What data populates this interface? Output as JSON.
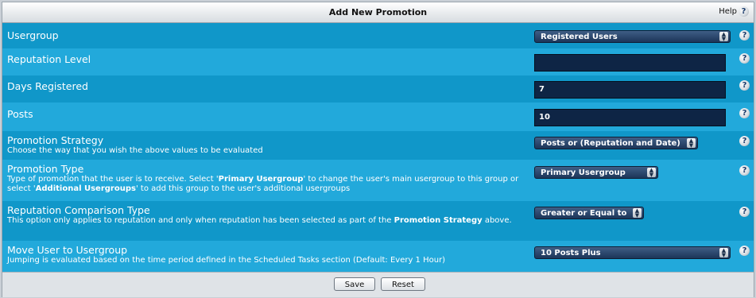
{
  "panel": {
    "title": "Add New Promotion",
    "help_label": "Help",
    "help_icon": "?"
  },
  "rows": [
    {
      "title": "Usergroup",
      "control": "select",
      "value": "Registered Users"
    },
    {
      "title": "Reputation Level",
      "control": "text",
      "value": ""
    },
    {
      "title": "Days Registered",
      "control": "text",
      "value": "7"
    },
    {
      "title": "Posts",
      "control": "text",
      "value": "10"
    },
    {
      "title": "Promotion Strategy",
      "desc": "Choose the way that you wish the above values to be evaluated",
      "control": "select",
      "value": "Posts or (Reputation and Date)"
    },
    {
      "title": "Promotion Type",
      "desc_parts": [
        "Type of promotion that the user is to receive. Select '",
        "Primary Usergroup",
        "' to change the user's main usergroup to this group or select '",
        "Additional Usergroups",
        "' to add this group to the user's additional usergroups"
      ],
      "control": "select",
      "value": "Primary Usergroup"
    },
    {
      "title": "Reputation Comparison Type",
      "desc_parts": [
        "This option only applies to reputation and only when reputation has been selected as part of the ",
        "Promotion Strategy",
        " above."
      ],
      "control": "select",
      "value": "Greater or Equal to"
    },
    {
      "title": "Move User to Usergroup",
      "desc": "Jumping is evaluated based on the time period defined in the Scheduled Tasks section (Default: Every 1 Hour)",
      "control": "select",
      "value": "10 Posts Plus"
    }
  ],
  "buttons": {
    "save": "Save",
    "reset": "Reset"
  },
  "colors": {
    "row_dark": "#1097c9",
    "row_light": "#22a9db",
    "input_bg": "#0e2545"
  },
  "icons": {
    "help": "question-icon",
    "select_arrows": "updown-arrows-icon"
  }
}
